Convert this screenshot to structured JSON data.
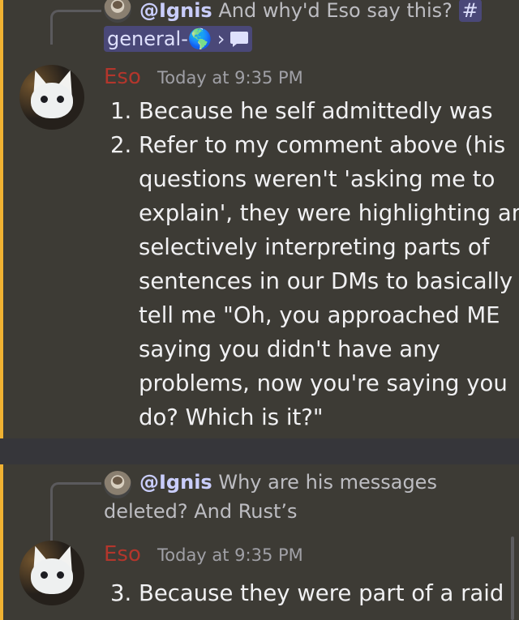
{
  "message1": {
    "reply": {
      "mention": "@Ignis",
      "text": "And why'd Eso say this?",
      "channel_hash": "#",
      "channel_name": "general-🌎",
      "chevron": "›",
      "chat_icon": "chat-bubble-icon"
    },
    "author": "Eso",
    "timestamp": "Today at 9:35 PM",
    "items": [
      "Because he self admittedly was",
      "Refer to my comment above (his questions weren't 'asking me to explain', they were highlighting and selectively interpreting parts of sentences in our DMs to basically tell me \"Oh, you approached ME saying you didn't have any problems, now you're saying you do? Which is it?\""
    ],
    "start": 1
  },
  "message2": {
    "reply": {
      "mention": "@Ignis",
      "text": "Why are his messages deleted? And Rust’s"
    },
    "author": "Eso",
    "timestamp": "Today at 9:35 PM",
    "items": [
      "Because they were part of a raid"
    ],
    "start": 3
  },
  "colors": {
    "background": "#36363a",
    "highlight_bg": "#3d3b35",
    "highlight_bar": "#f0b232",
    "author": "#b3362c",
    "mention": "#c9cdfb"
  }
}
